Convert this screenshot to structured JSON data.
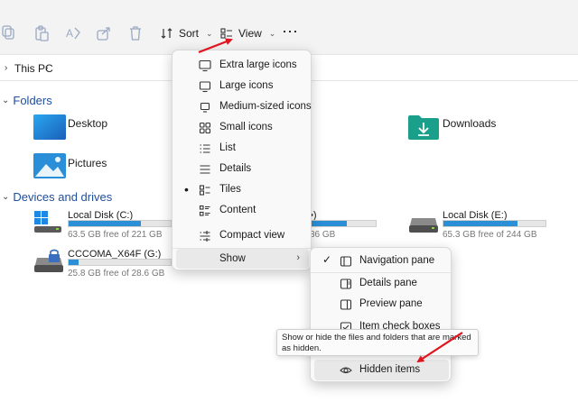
{
  "toolbar": {
    "sort_label": "Sort",
    "view_label": "View",
    "icons": [
      "copy-icon",
      "paste-icon",
      "rename-icon",
      "share-icon",
      "delete-icon"
    ]
  },
  "address": {
    "crumb": "This PC"
  },
  "folders": {
    "title": "Folders",
    "items": [
      {
        "name": "Desktop",
        "icon": "desktop-folder-icon"
      },
      {
        "name": "Downloads",
        "icon": "downloads-folder-icon"
      },
      {
        "name": "Pictures",
        "icon": "pictures-folder-icon"
      }
    ]
  },
  "drives": {
    "title": "Devices and drives",
    "items": [
      {
        "name": "Local Disk (C:)",
        "free": "63.5 GB free of 221 GB",
        "used_fraction": 0.71
      },
      {
        "name_partial": "•)",
        "free_partial": "36 GB",
        "used_fraction": 0.55
      },
      {
        "name": "Local Disk (E:)",
        "free": "65.3 GB free of 244 GB",
        "used_fraction": 0.73
      },
      {
        "name": "CCCOMA_X64F (G:)",
        "free": "25.8 GB free of 28.6 GB",
        "used_fraction": 0.1
      }
    ]
  },
  "view_menu": {
    "items": [
      {
        "label": "Extra large icons",
        "icon": "monitor-icon"
      },
      {
        "label": "Large icons",
        "icon": "monitor-icon"
      },
      {
        "label": "Medium-sized icons",
        "icon": "monitor-icon"
      },
      {
        "label": "Small icons",
        "icon": "small-icons-icon"
      },
      {
        "label": "List",
        "icon": "list-icon"
      },
      {
        "label": "Details",
        "icon": "details-icon"
      },
      {
        "label": "Tiles",
        "icon": "tiles-icon",
        "selected_marker": "•"
      },
      {
        "label": "Content",
        "icon": "content-icon"
      },
      {
        "label": "Compact view",
        "icon": "compact-view-icon"
      }
    ],
    "show_label": "Show",
    "show_arrow": "›"
  },
  "show_menu": {
    "items": [
      {
        "label": "Navigation pane",
        "checked": "✓",
        "icon": "navigation-pane-icon"
      },
      {
        "label": "Details pane",
        "icon": "details-pane-icon"
      },
      {
        "label": "Preview pane",
        "icon": "preview-pane-icon"
      },
      {
        "label": "Item check boxes",
        "icon": "check-boxes-icon"
      },
      {
        "label": "Hidden items",
        "icon": "eye-icon"
      }
    ]
  },
  "tooltip": {
    "text": "Show or hide the files and folders that are marked as hidden."
  },
  "colors": {
    "accent": "#2b8fd6",
    "annotation_arrow": "#e0141c",
    "group_title": "#1f4e9a"
  }
}
